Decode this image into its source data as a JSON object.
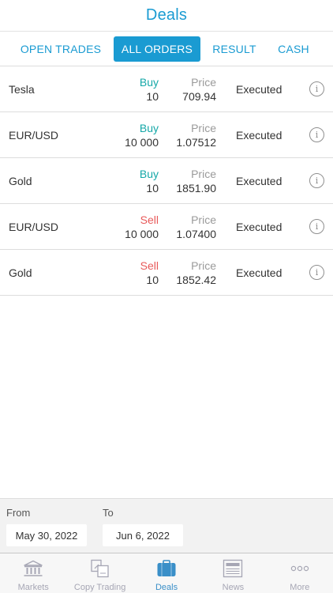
{
  "header": {
    "title": "Deals"
  },
  "tabs": [
    {
      "label": "OPEN TRADES",
      "active": false
    },
    {
      "label": "ALL ORDERS",
      "active": true
    },
    {
      "label": "RESULT",
      "active": false
    },
    {
      "label": "CASH",
      "active": false
    }
  ],
  "orders": [
    {
      "instrument": "Tesla",
      "side": "Buy",
      "quantity": "10",
      "price_label": "Price",
      "price": "709.94",
      "status": "Executed"
    },
    {
      "instrument": "EUR/USD",
      "side": "Buy",
      "quantity": "10 000",
      "price_label": "Price",
      "price": "1.07512",
      "status": "Executed"
    },
    {
      "instrument": "Gold",
      "side": "Buy",
      "quantity": "10",
      "price_label": "Price",
      "price": "1851.90",
      "status": "Executed"
    },
    {
      "instrument": "EUR/USD",
      "side": "Sell",
      "quantity": "10 000",
      "price_label": "Price",
      "price": "1.07400",
      "status": "Executed"
    },
    {
      "instrument": "Gold",
      "side": "Sell",
      "quantity": "10",
      "price_label": "Price",
      "price": "1852.42",
      "status": "Executed"
    }
  ],
  "info_glyph": "i",
  "date_range": {
    "from_label": "From",
    "from_value": "May 30, 2022",
    "to_label": "To",
    "to_value": "Jun 6, 2022"
  },
  "tabbar": [
    {
      "label": "Markets",
      "icon": "bank-icon",
      "active": false
    },
    {
      "label": "Copy Trading",
      "icon": "copy-trading-icon",
      "active": false
    },
    {
      "label": "Deals",
      "icon": "briefcase-icon",
      "active": true
    },
    {
      "label": "News",
      "icon": "newspaper-icon",
      "active": false
    },
    {
      "label": "More",
      "icon": "more-dots-icon",
      "active": false
    }
  ],
  "colors": {
    "accent": "#1a9bd2",
    "buy": "#16a8a8",
    "sell": "#e85a5a",
    "tabbar_inactive": "#a6a6b4",
    "tabbar_active": "#3a8fc8"
  }
}
